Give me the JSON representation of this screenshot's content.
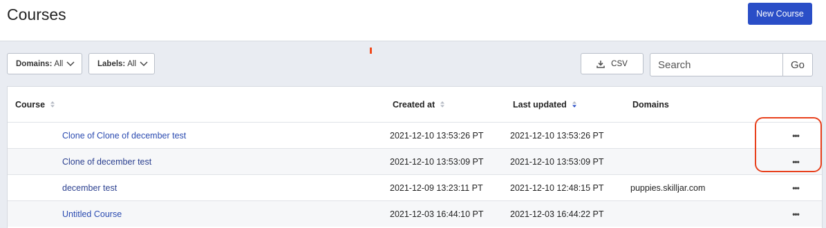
{
  "header": {
    "title": "Courses",
    "new_course_label": "New Course"
  },
  "filters": {
    "domains": {
      "label": "Domains:",
      "value": "All"
    },
    "labels": {
      "label": "Labels:",
      "value": "All"
    }
  },
  "toolbar": {
    "csv_label": "CSV",
    "search_placeholder": "Search",
    "go_label": "Go"
  },
  "table": {
    "columns": {
      "course": "Course",
      "created_at": "Created at",
      "last_updated": "Last updated",
      "domains": "Domains"
    },
    "sorted_by": "last_updated",
    "sort_direction": "descending",
    "rows": [
      {
        "course": "Clone of Clone of december test",
        "created_at": "2021-12-10 13:53:26 PT",
        "last_updated": "2021-12-10 13:53:26 PT",
        "domains": "",
        "actions": "•••",
        "link": true
      },
      {
        "course": "Clone of december test",
        "created_at": "2021-12-10 13:53:09 PT",
        "last_updated": "2021-12-10 13:53:09 PT",
        "domains": "",
        "actions": "•••",
        "link": false
      },
      {
        "course": "december test",
        "created_at": "2021-12-09 13:23:11 PT",
        "last_updated": "2021-12-10 12:48:15 PT",
        "domains": "puppies.skilljar.com",
        "actions": "•••",
        "link": false
      },
      {
        "course": "Untitled Course",
        "created_at": "2021-12-03 16:44:10 PT",
        "last_updated": "2021-12-03 16:44:22 PT",
        "domains": "",
        "actions": "•••",
        "link": true
      }
    ]
  },
  "colors": {
    "primary": "#2a4ec7",
    "link": "#2a4ab0",
    "annotation": "#e8401c"
  }
}
